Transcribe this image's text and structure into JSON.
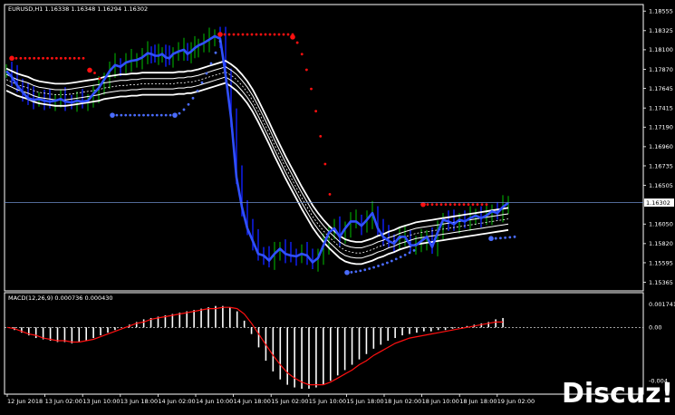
{
  "window": {
    "header": "EURUSD,H1  1.16338 1.16348 1.16294 1.16302",
    "current_price": "1.16302",
    "watermark": "Discuz!"
  },
  "colors": {
    "background": "#000000",
    "panel_border": "#ffffff",
    "price_line": "#3050ff",
    "bull_wick": "#00c000",
    "bear_body": "#1020ff",
    "channel": "#ffffff",
    "sar_red": "#ff1010",
    "sar_blue": "#4a6cff",
    "macd_hist": "#ffffff",
    "macd_signal": "#ff1010",
    "current_line": "#6c8cc8"
  },
  "chart_data": [
    {
      "type": "line",
      "symbol": "EURUSD",
      "timeframe": "H1",
      "ylim": [
        1.1536,
        1.186
      ],
      "y_ticks": [
        "1.18555",
        "1.18325",
        "1.18100",
        "1.17870",
        "1.17645",
        "1.17415",
        "1.17190",
        "1.16960",
        "1.16735",
        "1.16505",
        "1.16302",
        "1.16050",
        "1.15820",
        "1.15595",
        "1.15365"
      ],
      "x_ticks": [
        "12 Jun 2018",
        "13 Jun 02:00",
        "13 Jun 10:00",
        "13 Jun 18:00",
        "14 Jun 02:00",
        "14 Jun 10:00",
        "14 Jun 18:00",
        "15 Jun 02:00",
        "15 Jun 10:00",
        "15 Jun 18:00",
        "18 Jun 02:00",
        "18 Jun 10:00",
        "18 Jun 18:00",
        "19 Jun 02:00"
      ],
      "price_x": [
        0,
        6,
        12,
        18,
        24,
        30,
        36,
        42,
        48,
        54,
        60,
        65,
        72,
        78,
        84,
        90,
        96,
        102,
        108,
        114,
        120,
        126,
        132,
        138,
        144,
        150,
        156,
        160,
        164,
        168,
        172,
        176,
        180,
        184,
        190,
        196,
        200,
        204,
        208,
        212,
        218,
        224,
        230,
        236,
        242,
        248,
        254,
        260,
        266,
        272,
        278,
        284,
        290,
        296,
        302,
        308,
        314,
        320,
        326,
        332,
        338,
        344,
        350,
        356,
        362,
        368,
        374,
        380,
        386,
        392,
        398,
        404,
        410,
        416,
        422,
        428,
        434,
        440,
        446,
        452,
        458,
        464,
        470,
        476,
        482,
        488,
        494,
        500,
        506,
        512,
        518,
        524,
        530,
        536,
        542,
        548,
        554
      ],
      "price": [
        1.1785,
        1.1778,
        1.1768,
        1.176,
        1.1753,
        1.1751,
        1.1752,
        1.175,
        1.1749,
        1.175,
        1.1752,
        1.1749,
        1.1748,
        1.175,
        1.1749,
        1.175,
        1.1758,
        1.1765,
        1.1775,
        1.1785,
        1.1792,
        1.179,
        1.1795,
        1.1797,
        1.1798,
        1.1801,
        1.1806,
        1.1805,
        1.1803,
        1.1803,
        1.1805,
        1.1801,
        1.18,
        1.1805,
        1.1808,
        1.181,
        1.1805,
        1.1808,
        1.1812,
        1.1815,
        1.1818,
        1.1822,
        1.1826,
        1.1823,
        1.178,
        1.173,
        1.166,
        1.1625,
        1.16,
        1.1585,
        1.157,
        1.1568,
        1.1562,
        1.157,
        1.1576,
        1.157,
        1.1568,
        1.1567,
        1.157,
        1.1568,
        1.156,
        1.1565,
        1.158,
        1.1595,
        1.16,
        1.159,
        1.16,
        1.1608,
        1.1608,
        1.1603,
        1.161,
        1.1618,
        1.16,
        1.159,
        1.1585,
        1.1582,
        1.159,
        1.159,
        1.158,
        1.158,
        1.1585,
        1.159,
        1.1578,
        1.1595,
        1.161,
        1.1608,
        1.1605,
        1.161,
        1.1608,
        1.1612,
        1.1615,
        1.1612,
        1.1615,
        1.162,
        1.1618,
        1.1625,
        1.163
      ],
      "channel_mid": [
        1.1775,
        1.1772,
        1.1769,
        1.1767,
        1.1765,
        1.1762,
        1.176,
        1.1759,
        1.1758,
        1.1757,
        1.1757,
        1.1757,
        1.1758,
        1.1759,
        1.176,
        1.1761,
        1.1762,
        1.1763,
        1.1765,
        1.1766,
        1.1767,
        1.1768,
        1.1768,
        1.1769,
        1.1769,
        1.177,
        1.177,
        1.177,
        1.177,
        1.177,
        1.177,
        1.177,
        1.177,
        1.177,
        1.1771,
        1.1771,
        1.1772,
        1.1772,
        1.1773,
        1.1774,
        1.1776,
        1.1778,
        1.178,
        1.1782,
        1.1784,
        1.178,
        1.1775,
        1.1768,
        1.176,
        1.175,
        1.1738,
        1.1725,
        1.1712,
        1.1698,
        1.1685,
        1.1672,
        1.166,
        1.1648,
        1.1636,
        1.1625,
        1.1614,
        1.1605,
        1.1597,
        1.159,
        1.1584,
        1.1578,
        1.1574,
        1.1572,
        1.1571,
        1.1571,
        1.1573,
        1.1575,
        1.1578,
        1.158,
        1.1583,
        1.1585,
        1.1588,
        1.159,
        1.1592,
        1.1594,
        1.1595,
        1.1596,
        1.1597,
        1.1598,
        1.1599,
        1.16,
        1.1601,
        1.1602,
        1.1603,
        1.1604,
        1.1605,
        1.1606,
        1.1607,
        1.1608,
        1.1609,
        1.161,
        1.1611
      ],
      "channel_inner_width": 0.0006,
      "channel_outer_width": 0.0013,
      "sar_x": [
        [
          6,
          85
        ],
        [
          92,
          103
        ],
        [
          117,
          186
        ],
        [
          186,
          236
        ],
        [
          236,
          316
        ],
        [
          316,
          357
        ],
        [
          376,
          450
        ],
        [
          460,
          530
        ],
        [
          535,
          561
        ]
      ],
      "sar_y": [
        [
          1.18,
          1.18
        ],
        [
          1.1786,
          1.1776
        ],
        [
          1.1733,
          1.1733
        ],
        [
          1.1733,
          1.182
        ],
        [
          1.1828,
          1.1828
        ],
        [
          1.1825,
          1.164
        ],
        [
          1.1548,
          1.1574
        ],
        [
          1.1628,
          1.1628
        ],
        [
          1.1588,
          1.159
        ]
      ],
      "sar_colors": [
        "red",
        "red",
        "blue",
        "blue",
        "red",
        "red",
        "blue",
        "red",
        "blue"
      ]
    },
    {
      "type": "bar",
      "title": "MACD(12,26,9) 0.000736 0.000430",
      "y_ticks": [
        "0.001741",
        "0.00",
        "-0.004"
      ],
      "ylim": [
        -0.0048,
        0.00185
      ],
      "histogram": [
        0.0,
        -0.0002,
        -0.0004,
        -0.0006,
        -0.0008,
        -0.0009,
        -0.001,
        -0.0011,
        -0.0011,
        -0.0012,
        -0.0011,
        -0.001,
        -0.0008,
        -0.0006,
        -0.0004,
        -0.0002,
        0.0,
        0.0002,
        0.0004,
        0.0006,
        0.0007,
        0.0008,
        0.0009,
        0.001,
        0.0011,
        0.0012,
        0.0013,
        0.0014,
        0.0015,
        0.0016,
        0.0016,
        0.0015,
        0.0012,
        0.0005,
        -0.0005,
        -0.0015,
        -0.0025,
        -0.0033,
        -0.0039,
        -0.0043,
        -0.0045,
        -0.0046,
        -0.0046,
        -0.0045,
        -0.0043,
        -0.004,
        -0.0036,
        -0.0032,
        -0.0028,
        -0.0024,
        -0.002,
        -0.0016,
        -0.0013,
        -0.001,
        -0.0008,
        -0.0006,
        -0.0005,
        -0.0004,
        -0.0003,
        -0.0003,
        -0.0002,
        -0.0002,
        -0.0001,
        0.0,
        0.0001,
        0.0002,
        0.0003,
        0.0004,
        0.0006,
        0.0007
      ],
      "signal": [
        0.0,
        -0.0001,
        -0.0003,
        -0.0005,
        -0.0006,
        -0.0008,
        -0.0009,
        -0.001,
        -0.001,
        -0.0011,
        -0.0011,
        -0.001,
        -0.0009,
        -0.0007,
        -0.0005,
        -0.0003,
        -0.0001,
        0.0001,
        0.0003,
        0.0004,
        0.0006,
        0.0007,
        0.0008,
        0.0009,
        0.001,
        0.0011,
        0.0012,
        0.0013,
        0.0014,
        0.0014,
        0.0015,
        0.0015,
        0.0014,
        0.001,
        0.0003,
        -0.0005,
        -0.0013,
        -0.0021,
        -0.0028,
        -0.0034,
        -0.0038,
        -0.0041,
        -0.0043,
        -0.0043,
        -0.0043,
        -0.0041,
        -0.0038,
        -0.0035,
        -0.0032,
        -0.0028,
        -0.0025,
        -0.0021,
        -0.0018,
        -0.0015,
        -0.0012,
        -0.001,
        -0.0008,
        -0.0007,
        -0.0006,
        -0.0005,
        -0.0004,
        -0.0003,
        -0.0002,
        -0.0001,
        0.0,
        0.0001,
        0.0002,
        0.0003,
        0.0004,
        0.0004
      ]
    }
  ]
}
